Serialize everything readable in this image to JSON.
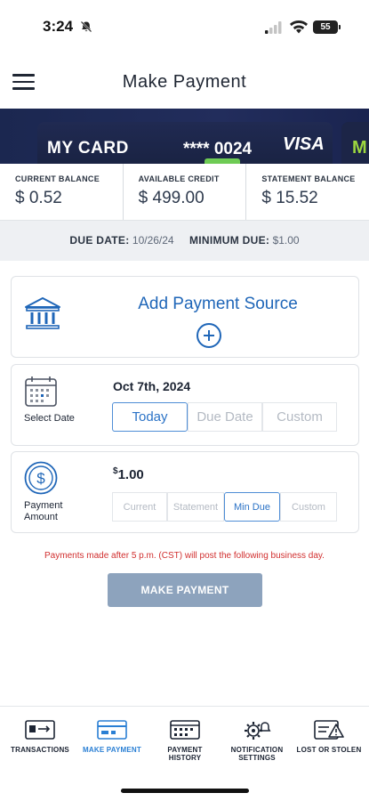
{
  "status_bar": {
    "time": "3:24",
    "battery": "55"
  },
  "header": {
    "title": "Make Payment"
  },
  "card": {
    "name": "MY CARD",
    "number": "**** 0024",
    "brand": "VISA",
    "next_card_initial": "M"
  },
  "balances": [
    {
      "label": "CURRENT BALANCE",
      "value": "$ 0.52"
    },
    {
      "label": "AVAILABLE CREDIT",
      "value": "$ 499.00"
    },
    {
      "label": "STATEMENT BALANCE",
      "value": "$ 15.52"
    }
  ],
  "due": {
    "due_date_label": "DUE DATE:",
    "due_date": "10/26/24",
    "minimum_due_label": "MINIMUM DUE:",
    "minimum_due": "$1.00"
  },
  "payment_source": {
    "label": "Add Payment Source"
  },
  "select_date": {
    "label": "Select Date",
    "value": "Oct 7th, 2024",
    "options": [
      "Today",
      "Due Date",
      "Custom"
    ],
    "selected": "Today"
  },
  "payment_amount": {
    "label_line1": "Payment",
    "label_line2": "Amount",
    "currency": "$",
    "value": "1.00",
    "options": [
      "Current",
      "Statement",
      "Min Due",
      "Custom"
    ],
    "selected": "Min Due"
  },
  "notice": "Payments made after 5 p.m. (CST) will post the following business day.",
  "submit": {
    "label": "MAKE PAYMENT"
  },
  "bottom_nav": [
    {
      "line1": "TRANSACTIONS",
      "line2": "",
      "icon": "transactions-icon",
      "active": false
    },
    {
      "line1": "MAKE PAYMENT",
      "line2": "",
      "icon": "payment-card-icon",
      "active": true
    },
    {
      "line1": "PAYMENT",
      "line2": "HISTORY",
      "icon": "calendar-icon",
      "active": false
    },
    {
      "line1": "NOTIFICATION",
      "line2": "SETTINGS",
      "icon": "gear-bell-icon",
      "active": false
    },
    {
      "line1": "LOST OR STOLEN",
      "line2": "",
      "icon": "card-warning-icon",
      "active": false
    }
  ],
  "colors": {
    "accent": "#1f66b8",
    "active_nav": "#2a7fd4",
    "notice": "#d12f2f",
    "card_band": "#1b2750",
    "button": "#8da3bd"
  }
}
